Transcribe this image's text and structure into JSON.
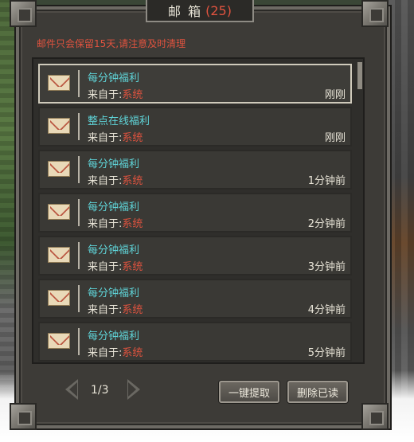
{
  "window": {
    "title": "邮 箱",
    "count": "(25)",
    "notice": "邮件只会保留15天,请注意及时清理"
  },
  "mails": [
    {
      "title": "每分钟福利",
      "from_label": "来自于:",
      "source": "系统",
      "time": "刚刚",
      "selected": true
    },
    {
      "title": "整点在线福利",
      "from_label": "来自于:",
      "source": "系统",
      "time": "刚刚",
      "selected": false
    },
    {
      "title": "每分钟福利",
      "from_label": "来自于:",
      "source": "系统",
      "time": "1分钟前",
      "selected": false
    },
    {
      "title": "每分钟福利",
      "from_label": "来自于:",
      "source": "系统",
      "time": "2分钟前",
      "selected": false
    },
    {
      "title": "每分钟福利",
      "from_label": "来自于:",
      "source": "系统",
      "time": "3分钟前",
      "selected": false
    },
    {
      "title": "每分钟福利",
      "from_label": "来自于:",
      "source": "系统",
      "time": "4分钟前",
      "selected": false
    },
    {
      "title": "每分钟福利",
      "from_label": "来自于:",
      "source": "系统",
      "time": "5分钟前",
      "selected": false
    }
  ],
  "pagination": {
    "page": "1/3",
    "prev_icon": "arrow-left-icon",
    "next_icon": "arrow-right-icon"
  },
  "buttons": {
    "claim_all": "一键提取",
    "delete_read": "删除已读"
  },
  "icons": {
    "mail": "envelope-icon"
  },
  "colors": {
    "title_cyan": "#5fd4d8",
    "accent_red": "#e0533f",
    "text_light": "#e9e5d8"
  }
}
